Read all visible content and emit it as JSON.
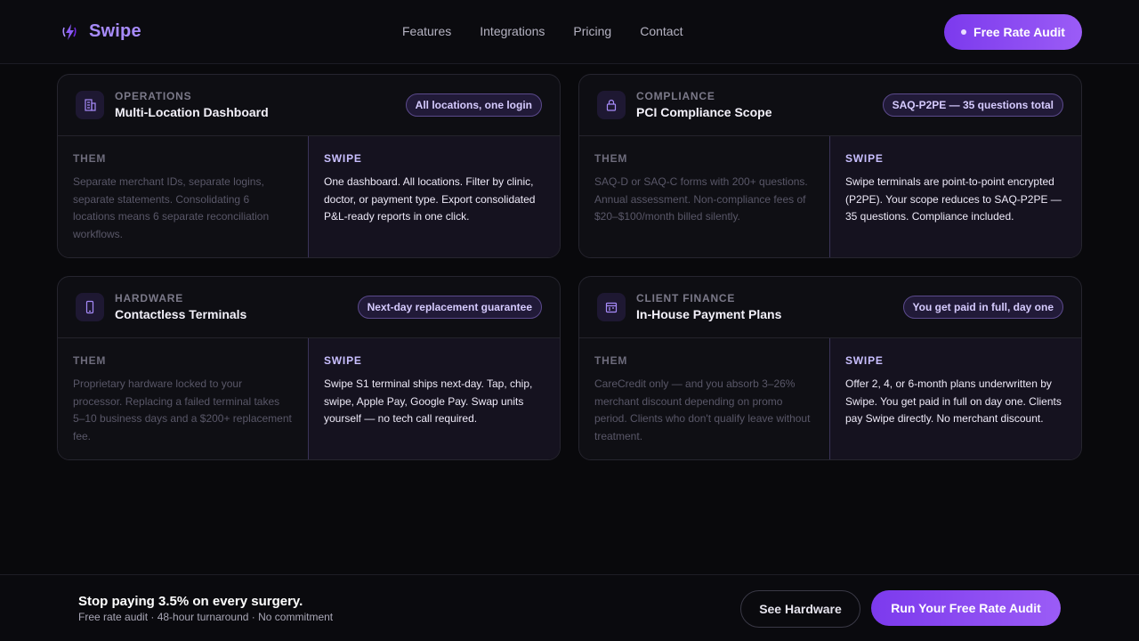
{
  "header": {
    "brand": "Swipe",
    "nav": [
      "Features",
      "Integrations",
      "Pricing",
      "Contact"
    ],
    "cta": "Free Rate Audit"
  },
  "cards": [
    {
      "category": "OPERATIONS",
      "title": "Multi-Location Dashboard",
      "badge": "All locations, one login",
      "icon": "building-icon",
      "them_label": "THEM",
      "them_text": "Separate merchant IDs, separate logins, separate statements. Consolidating 6 locations means 6 separate reconciliation workflows.",
      "swipe_label": "SWIPE",
      "swipe_text": "One dashboard. All locations. Filter by clinic, doctor, or payment type. Export consolidated P&L-ready reports in one click."
    },
    {
      "category": "COMPLIANCE",
      "title": "PCI Compliance Scope",
      "badge": "SAQ-P2PE — 35 questions total",
      "icon": "lock-icon",
      "them_label": "THEM",
      "them_text": "SAQ-D or SAQ-C forms with 200+ questions. Annual assessment. Non-compliance fees of $20–$100/month billed silently.",
      "swipe_label": "SWIPE",
      "swipe_text": "Swipe terminals are point-to-point encrypted (P2PE). Your scope reduces to SAQ-P2PE — 35 questions. Compliance included."
    },
    {
      "category": "HARDWARE",
      "title": "Contactless Terminals",
      "badge": "Next-day replacement guarantee",
      "icon": "phone-icon",
      "them_label": "THEM",
      "them_text": "Proprietary hardware locked to your processor. Replacing a failed terminal takes 5–10 business days and a $200+ replacement fee.",
      "swipe_label": "SWIPE",
      "swipe_text": "Swipe S1 terminal ships next-day. Tap, chip, swipe, Apple Pay, Google Pay. Swap units yourself — no tech call required."
    },
    {
      "category": "CLIENT FINANCE",
      "title": "In-House Payment Plans",
      "badge": "You get paid in full, day one",
      "icon": "calendar-icon",
      "them_label": "THEM",
      "them_text": "CareCredit only — and you absorb 3–26% merchant discount depending on promo period. Clients who don't qualify leave without treatment.",
      "swipe_label": "SWIPE",
      "swipe_text": "Offer 2, 4, or 6-month plans underwritten by Swipe. You get paid in full on day one. Clients pay Swipe directly. No merchant discount."
    }
  ],
  "bottom_bar": {
    "title": "Stop paying 3.5% on every surgery.",
    "subtitle": "Free rate audit · 48-hour turnaround · No commitment",
    "secondary_button": "See Hardware",
    "primary_button": "Run Your Free Rate Audit"
  },
  "colors": {
    "accent": "#8b5cf6",
    "background": "#09090c"
  }
}
